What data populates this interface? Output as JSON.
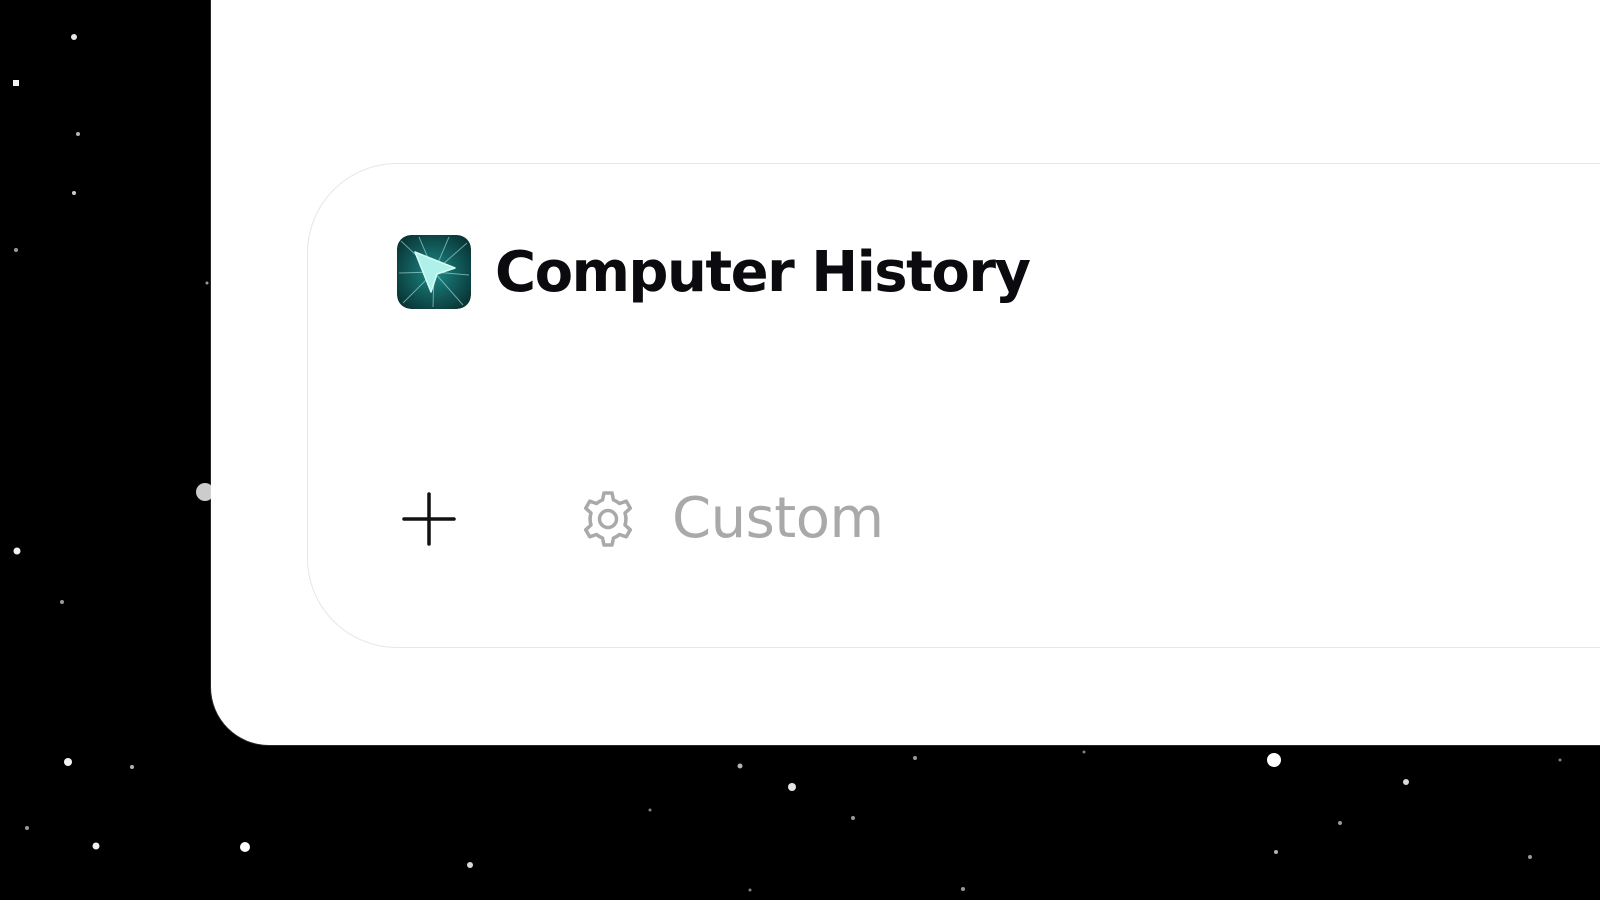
{
  "app": {
    "title": "Computer History",
    "icon": "cursor-arrow-icon",
    "icon_colors": {
      "background": "#0f4f4f",
      "arrow": "#aef0ea"
    }
  },
  "actions": {
    "add_icon": "plus-icon",
    "custom_label": "Custom",
    "custom_icon": "gear-icon"
  },
  "colors": {
    "background": "#000000",
    "window": "#ffffff",
    "title_text": "#0b0b0f",
    "muted_text": "#a9a9a9",
    "card_border": "#e6e6e6"
  }
}
